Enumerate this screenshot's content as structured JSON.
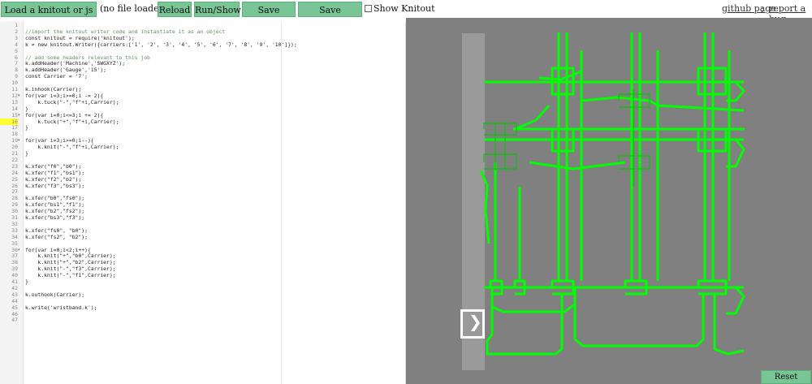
{
  "toolbar": {
    "load_label": "Load a knitout or js file",
    "file_status": "(no file loaded)",
    "reload_label": "Reload",
    "runshow_label": "Run/Show",
    "save_knitout_label": "Save Knitout",
    "save_js_label": "Save Javascript",
    "show_knitout_label": "Show Knitout",
    "github_label": "github page",
    "separator": ";",
    "bug_label": "report a bug"
  },
  "editor": {
    "highlight_line": 16,
    "lines": [
      {
        "n": "1",
        "t": ""
      },
      {
        "n": "2",
        "t": "//import the knitout writer code and instantiate it as an object"
      },
      {
        "n": "3",
        "t": "const knitout = require('knitout');"
      },
      {
        "n": "4",
        "t": "k = new knitout.Writer({carriers:['1', '2', '3', '4', '5', '6', '7', '8', '9', '10']});"
      },
      {
        "n": "5",
        "t": ""
      },
      {
        "n": "6",
        "t": "// add some headers relevant to this job"
      },
      {
        "n": "7",
        "t": "k.addHeader('Machine','SWGXYZ');"
      },
      {
        "n": "8",
        "t": "k.addHeader('Gauge','15');"
      },
      {
        "n": "9",
        "t": "const Carrier = '7';"
      },
      {
        "n": "10",
        "t": ""
      },
      {
        "n": "11",
        "t": "k.inhook(Carrier);"
      },
      {
        "n": "12",
        "t": "for(var i=3;i>=0;i -= 2){",
        "fold": true
      },
      {
        "n": "13",
        "t": "    k.tuck(\"-\",\"f\"+i,Carrier);"
      },
      {
        "n": "14",
        "t": "}"
      },
      {
        "n": "15",
        "t": "for(var i=0;i<=3;i += 2){",
        "fold": true
      },
      {
        "n": "16",
        "t": "    k.tuck(\"+\",\"f\"+i,Carrier);"
      },
      {
        "n": "17",
        "t": "}"
      },
      {
        "n": "18",
        "t": ""
      },
      {
        "n": "19",
        "t": "for(var i=3;i>=0;i--){",
        "fold": true
      },
      {
        "n": "20",
        "t": "    k.knit(\"-\",\"f\"+i,Carrier);"
      },
      {
        "n": "21",
        "t": "}"
      },
      {
        "n": "22",
        "t": ""
      },
      {
        "n": "23",
        "t": "k.xfer(\"f0\",\"b0\");"
      },
      {
        "n": "24",
        "t": "k.xfer(\"f1\",\"bs1\");"
      },
      {
        "n": "25",
        "t": "k.xfer(\"f2\",\"b2\");"
      },
      {
        "n": "26",
        "t": "k.xfer(\"f3\",\"bs3\");"
      },
      {
        "n": "27",
        "t": ""
      },
      {
        "n": "28",
        "t": "k.xfer(\"b0\",\"fs0\");"
      },
      {
        "n": "29",
        "t": "k.xfer(\"bs1\",\"f1\");"
      },
      {
        "n": "30",
        "t": "k.xfer(\"b2\",\"fs2\");"
      },
      {
        "n": "31",
        "t": "k.xfer(\"bs3\",\"f3\");"
      },
      {
        "n": "32",
        "t": ""
      },
      {
        "n": "33",
        "t": "k.xfer(\"fs0\", \"b0\");"
      },
      {
        "n": "34",
        "t": "k.xfer(\"fs2\", \"b2\");"
      },
      {
        "n": "35",
        "t": ""
      },
      {
        "n": "36",
        "t": "for(var i=0;i<2;i++){",
        "fold": true
      },
      {
        "n": "37",
        "t": "    k.knit(\"+\",\"b0\",Carrier);"
      },
      {
        "n": "38",
        "t": "    k.knit(\"+\",\"b2\",Carrier);"
      },
      {
        "n": "39",
        "t": "    k.knit(\"-\",\"f3\",Carrier);"
      },
      {
        "n": "40",
        "t": "    k.knit(\"-\",\"f1\",Carrier);"
      },
      {
        "n": "41",
        "t": "}"
      },
      {
        "n": "42",
        "t": ""
      },
      {
        "n": "43",
        "t": "k.outhook(Carrier);"
      },
      {
        "n": "44",
        "t": ""
      },
      {
        "n": "45",
        "t": "k.write('wristband.k');"
      },
      {
        "n": "46",
        "t": ""
      },
      {
        "n": "47",
        "t": ""
      }
    ]
  },
  "viewer": {
    "reset_zoom_label": "Reset Zoom",
    "yarn_color": "#00ff00",
    "background_color": "#808080",
    "hand_glyph": "❯"
  }
}
